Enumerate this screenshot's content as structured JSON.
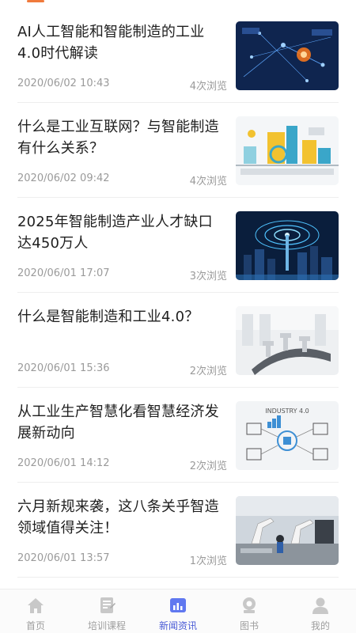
{
  "news": [
    {
      "title": "AI人工智能和智能制造的工业4.0时代解读",
      "date": "2020/06/02 10:43",
      "views": "4次浏览",
      "thumb_icon": "network-tech-image"
    },
    {
      "title": "什么是工业互联网？与智能制造有什么关系？",
      "date": "2020/06/02 09:42",
      "views": "4次浏览",
      "thumb_icon": "factory-illustration-image"
    },
    {
      "title": "2025年智能制造产业人才缺口达450万人",
      "date": "2020/06/01 17:07",
      "views": "3次浏览",
      "thumb_icon": "city-signal-tower-image"
    },
    {
      "title": "什么是智能制造和工业4.0？",
      "date": "2020/06/01 15:36",
      "views": "2次浏览",
      "thumb_icon": "robot-conveyor-image"
    },
    {
      "title": "从工业生产智慧化看智慧经济发展新动向",
      "date": "2020/06/01 14:12",
      "views": "2次浏览",
      "thumb_icon": "industry-diagram-image",
      "thumb_text": "INDUSTRY 4.0"
    },
    {
      "title": "六月新规来袭，这八条关乎智造领域值得关注！",
      "date": "2020/06/01 13:57",
      "views": "1次浏览",
      "thumb_icon": "robot-arms-factory-image"
    }
  ],
  "tabbar": {
    "items": [
      {
        "label": "首页",
        "icon": "home-icon"
      },
      {
        "label": "培训课程",
        "icon": "course-icon"
      },
      {
        "label": "新闻资讯",
        "icon": "news-icon",
        "active": true
      },
      {
        "label": "图书",
        "icon": "book-icon"
      },
      {
        "label": "我的",
        "icon": "profile-icon"
      }
    ]
  },
  "colors": {
    "accent": "#f07a3c",
    "active_tab": "#4a5bd6",
    "meta_text": "#9a9a9a"
  }
}
